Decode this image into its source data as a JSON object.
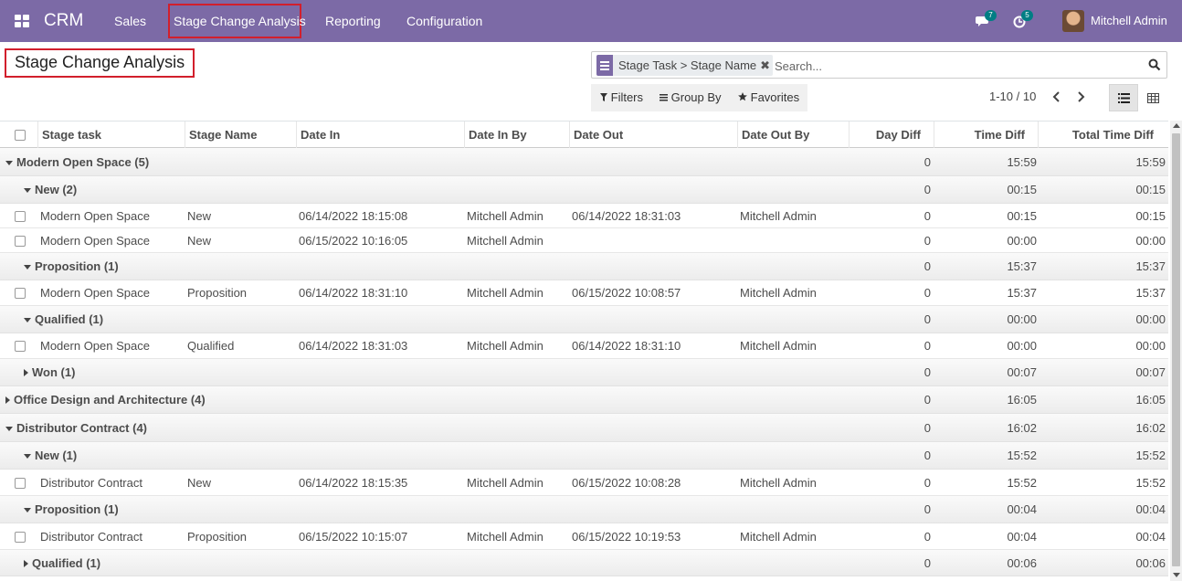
{
  "navbar": {
    "brand": "CRM",
    "menu": [
      "Sales",
      "Stage Change Analysis",
      "Reporting",
      "Configuration"
    ],
    "messages_count": "7",
    "activities_count": "5",
    "user_name": "Mitchell Admin",
    "color": "#7c6aa6"
  },
  "control_panel": {
    "title": "Stage Change Analysis",
    "search_facet": "Stage Task > Stage Name",
    "search_placeholder": "Search...",
    "filters_label": "Filters",
    "group_by_label": "Group By",
    "favorites_label": "Favorites",
    "pager": "1-10 / 10"
  },
  "table": {
    "columns": [
      "Stage task",
      "Stage Name",
      "Date In",
      "Date In By",
      "Date Out",
      "Date Out By",
      "Day Diff",
      "Time Diff",
      "Total Time Diff"
    ],
    "rows": [
      {
        "kind": "group",
        "level": 0,
        "open": true,
        "label": "Modern Open Space (5)",
        "day": "0",
        "time": "15:59",
        "total": "15:59"
      },
      {
        "kind": "group",
        "level": 1,
        "open": true,
        "label": "New (2)",
        "day": "0",
        "time": "00:15",
        "total": "00:15"
      },
      {
        "kind": "record",
        "task": "Modern Open Space",
        "stage": "New",
        "date_in": "06/14/2022 18:15:08",
        "in_by": "Mitchell Admin",
        "date_out": "06/14/2022 18:31:03",
        "out_by": "Mitchell Admin",
        "day": "0",
        "time": "00:15",
        "total": "00:15"
      },
      {
        "kind": "record",
        "task": "Modern Open Space",
        "stage": "New",
        "date_in": "06/15/2022 10:16:05",
        "in_by": "Mitchell Admin",
        "date_out": "",
        "out_by": "",
        "day": "0",
        "time": "00:00",
        "total": "00:00"
      },
      {
        "kind": "group",
        "level": 1,
        "open": true,
        "label": "Proposition (1)",
        "day": "0",
        "time": "15:37",
        "total": "15:37"
      },
      {
        "kind": "record",
        "task": "Modern Open Space",
        "stage": "Proposition",
        "date_in": "06/14/2022 18:31:10",
        "in_by": "Mitchell Admin",
        "date_out": "06/15/2022 10:08:57",
        "out_by": "Mitchell Admin",
        "day": "0",
        "time": "15:37",
        "total": "15:37"
      },
      {
        "kind": "group",
        "level": 1,
        "open": true,
        "label": "Qualified (1)",
        "day": "0",
        "time": "00:00",
        "total": "00:00"
      },
      {
        "kind": "record",
        "task": "Modern Open Space",
        "stage": "Qualified",
        "date_in": "06/14/2022 18:31:03",
        "in_by": "Mitchell Admin",
        "date_out": "06/14/2022 18:31:10",
        "out_by": "Mitchell Admin",
        "day": "0",
        "time": "00:00",
        "total": "00:00"
      },
      {
        "kind": "group",
        "level": 1,
        "open": false,
        "label": "Won (1)",
        "day": "0",
        "time": "00:07",
        "total": "00:07"
      },
      {
        "kind": "group",
        "level": 0,
        "open": false,
        "label": "Office Design and Architecture (4)",
        "day": "0",
        "time": "16:05",
        "total": "16:05"
      },
      {
        "kind": "group",
        "level": 0,
        "open": true,
        "label": "Distributor Contract (4)",
        "day": "0",
        "time": "16:02",
        "total": "16:02"
      },
      {
        "kind": "group",
        "level": 1,
        "open": true,
        "label": "New (1)",
        "day": "0",
        "time": "15:52",
        "total": "15:52"
      },
      {
        "kind": "record",
        "task": "Distributor Contract",
        "stage": "New",
        "date_in": "06/14/2022 18:15:35",
        "in_by": "Mitchell Admin",
        "date_out": "06/15/2022 10:08:28",
        "out_by": "Mitchell Admin",
        "day": "0",
        "time": "15:52",
        "total": "15:52"
      },
      {
        "kind": "group",
        "level": 1,
        "open": true,
        "label": "Proposition (1)",
        "day": "0",
        "time": "00:04",
        "total": "00:04"
      },
      {
        "kind": "record",
        "task": "Distributor Contract",
        "stage": "Proposition",
        "date_in": "06/15/2022 10:15:07",
        "in_by": "Mitchell Admin",
        "date_out": "06/15/2022 10:19:53",
        "out_by": "Mitchell Admin",
        "day": "0",
        "time": "00:04",
        "total": "00:04"
      },
      {
        "kind": "group",
        "level": 1,
        "open": false,
        "label": "Qualified (1)",
        "day": "0",
        "time": "00:06",
        "total": "00:06"
      }
    ]
  }
}
